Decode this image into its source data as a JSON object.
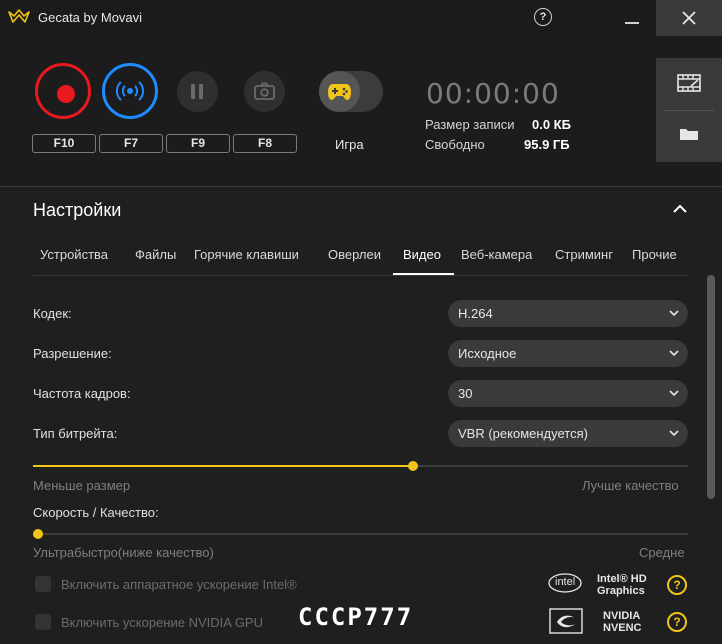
{
  "app": {
    "title": "Gecata by Movavi",
    "help": "?"
  },
  "colors": {
    "record": "#e8191f",
    "stream": "#1e8bff",
    "accent": "#f0c419"
  },
  "controls": {
    "hotkeys": [
      "F10",
      "F7",
      "F9",
      "F8"
    ],
    "game_mode_label": "Игра",
    "timer": "00:00:00",
    "record_size_label": "Размер записи",
    "record_size_value": "0.0 КБ",
    "free_label": "Свободно",
    "free_value": "95.9 ГБ"
  },
  "settings": {
    "title": "Настройки",
    "tabs": [
      "Устройства",
      "Файлы",
      "Горячие клавиши",
      "Оверлеи",
      "Видео",
      "Веб-камера",
      "Стриминг",
      "Прочие"
    ],
    "active_tab": "Видео",
    "codec_label": "Кодек:",
    "codec_value": "H.264",
    "resolution_label": "Разрешение:",
    "resolution_value": "Исходное",
    "fps_label": "Частота кадров:",
    "fps_value": "30",
    "bitrate_label": "Тип битрейта:",
    "bitrate_value": "VBR (рекомендуется)",
    "quality_slider": {
      "value": 0.58,
      "min_label": "Меньше размер",
      "max_label": "Лучше качество"
    },
    "speed_label": "Скорость / Качество:",
    "speed_slider": {
      "value": 0.0,
      "min_label": "Ультрабыстро(ниже качество)",
      "max_label": "Средне"
    },
    "intel_accel_label": "Включить аппаратное ускорение Intel®",
    "nvidia_accel_label": "Включить ускорение NVIDIA GPU",
    "intel_logo": "intel",
    "intel_product": "Intel® HD Graphics",
    "nvidia_product": "NVIDIA NVENC",
    "help": "?"
  },
  "watermark": "СССР777"
}
